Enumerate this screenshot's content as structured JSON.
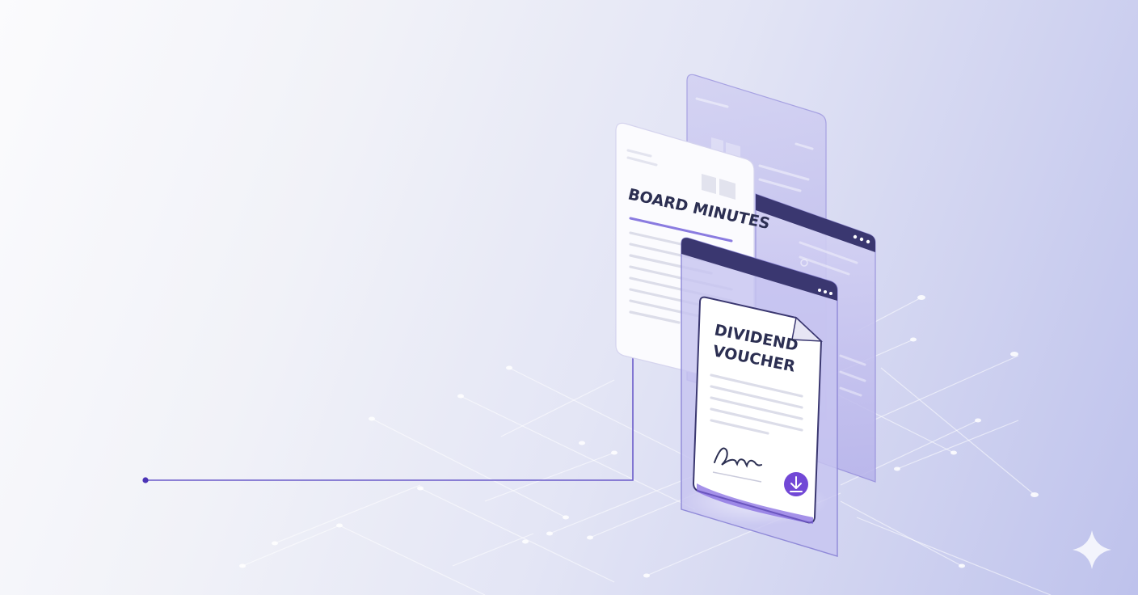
{
  "illustration": {
    "board_minutes": {
      "title": "BOARD MINUTES"
    },
    "dividend_voucher": {
      "title_line1": "DIVIDEND",
      "title_line2": "VOUCHER"
    },
    "icons": [
      "download-icon",
      "signature-mark",
      "sparkle-icon"
    ],
    "colors": {
      "accent": "#6a4bd1",
      "ink": "#2c2f52",
      "panel": "#c8c6ef",
      "paper": "#ffffff"
    }
  }
}
